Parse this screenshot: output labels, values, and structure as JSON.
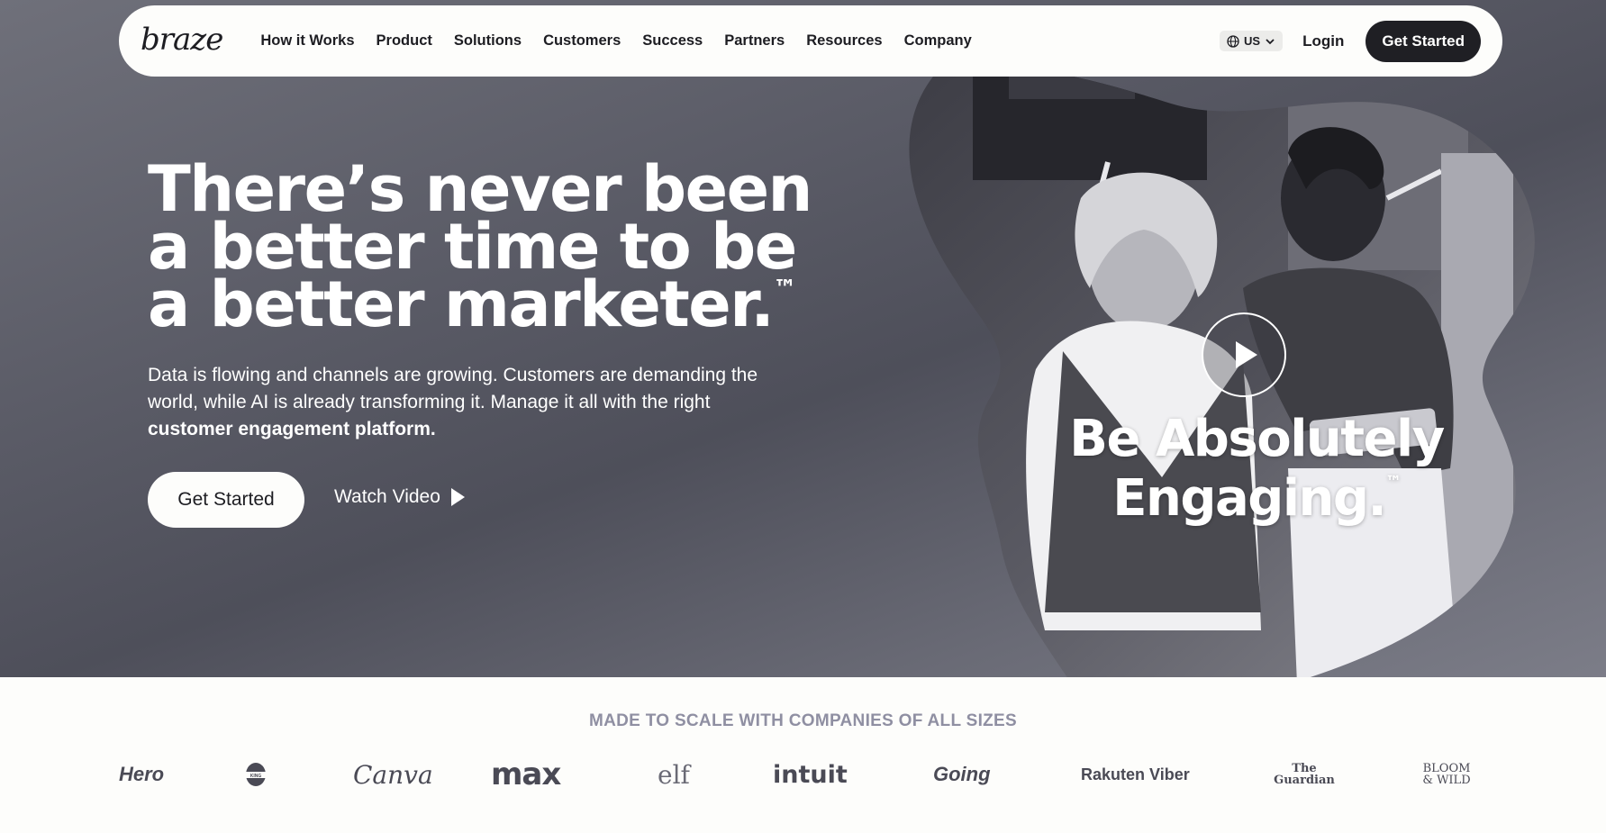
{
  "nav": {
    "logo": "braze",
    "links": [
      "How it Works",
      "Product",
      "Solutions",
      "Customers",
      "Success",
      "Partners",
      "Resources",
      "Company"
    ],
    "locale": "US",
    "login": "Login",
    "cta": "Get Started"
  },
  "hero": {
    "headline": "There’s never been a better time to be a better marketer.",
    "headline_tm": "™",
    "subtext": "Data is flowing and channels are growing. Customers are demanding the world, while AI is already transforming it. Manage it all with the right ",
    "subtext_bold": "customer engagement platform.",
    "cta": "Get Started",
    "watch_video": "Watch Video",
    "tagline_line1": "Be Absolutely",
    "tagline_line2": "Engaging.",
    "tagline_tm": "™"
  },
  "logos": {
    "title": "MADE TO SCALE WITH COMPANIES OF ALL SIZES",
    "items": [
      "Hero",
      "BURGER KING",
      "Canva",
      "max",
      "elf",
      "intuit",
      "Going",
      "Rakuten Viber",
      "The Guardian",
      "BLOOM & WILD"
    ]
  },
  "colors": {
    "nav_bg": "#fdfdfb",
    "hero_bg": "#5a5b66",
    "dark_button": "#1f1f24",
    "logos_title": "#8f8fa2"
  }
}
